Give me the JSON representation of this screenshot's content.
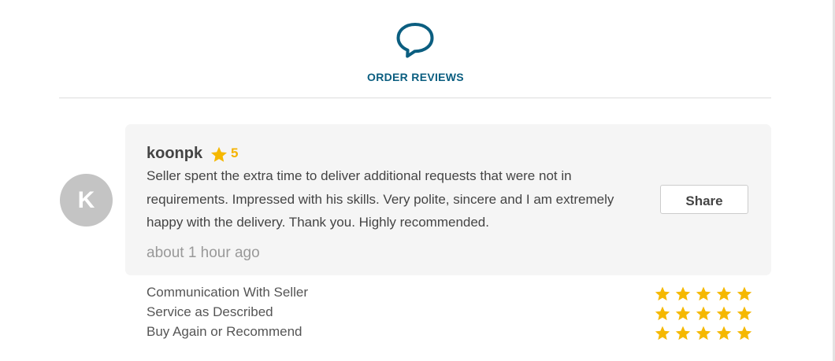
{
  "header": {
    "title": "ORDER REVIEWS",
    "icon": "speech-bubble-icon",
    "accent_color": "#0b5e80"
  },
  "review": {
    "avatar_initial": "K",
    "reviewer_name": "koonpk",
    "rating": "5",
    "text": "Seller spent the extra time to deliver additional requests that were not in requirements. Impressed with his skills. Very polite, sincere and I am extremely happy with the delivery. Thank you. Highly recommended.",
    "time": "about 1 hour ago",
    "share_label": "Share"
  },
  "breakdown": [
    {
      "label": "Communication With Seller",
      "stars": 5
    },
    {
      "label": "Service as Described",
      "stars": 5
    },
    {
      "label": "Buy Again or Recommend",
      "stars": 5
    }
  ],
  "colors": {
    "star": "#f5b800"
  }
}
